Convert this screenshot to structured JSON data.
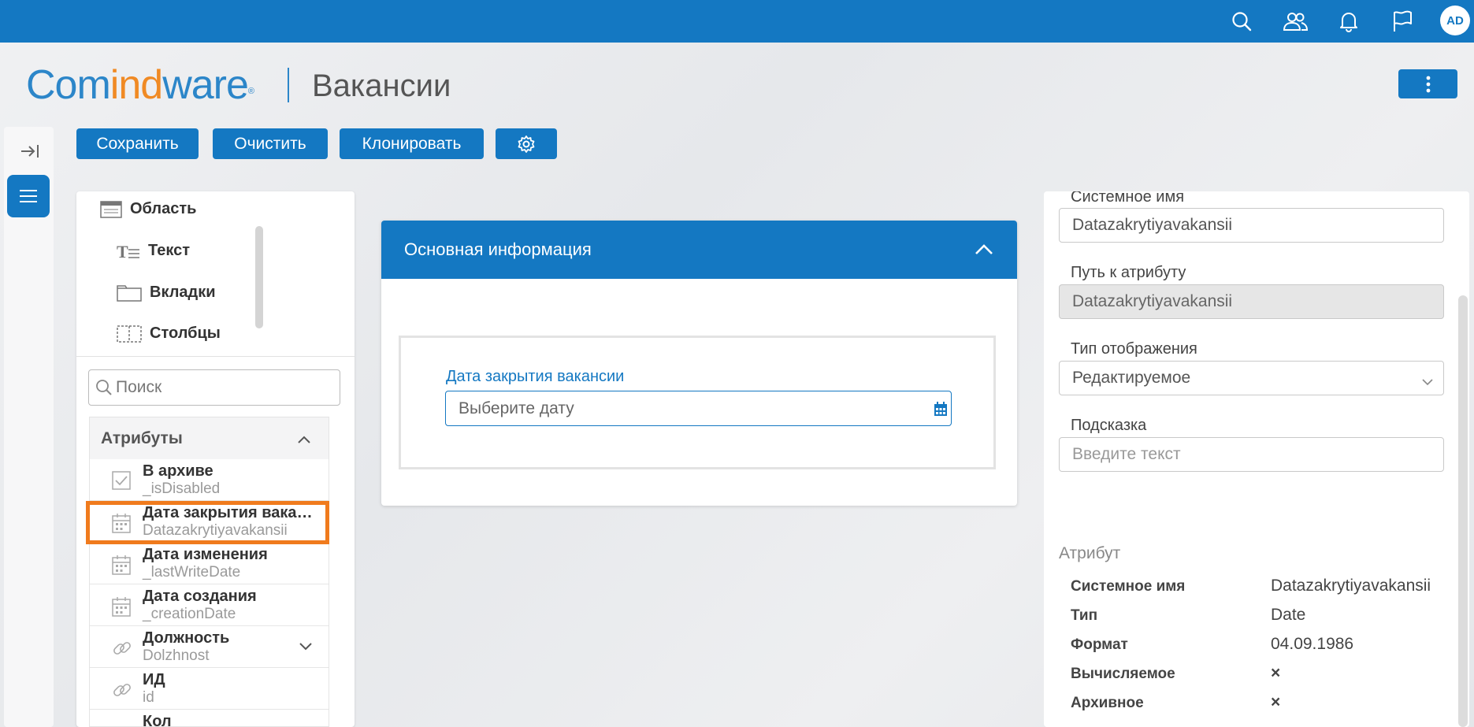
{
  "topbar": {
    "icons": [
      "search-icon",
      "users-icon",
      "bell-icon",
      "flag-icon"
    ],
    "avatar": "AD",
    "accent": "#1478c2"
  },
  "header": {
    "logo": {
      "part1": "Com",
      "part2": "ind",
      "part3": "ware",
      "mark": "®"
    },
    "title": "Вакансии"
  },
  "toolbar": {
    "save_label": "Сохранить",
    "clear_label": "Очистить",
    "clone_label": "Клонировать"
  },
  "palette": {
    "items": [
      {
        "label": "Область",
        "icon": "area-icon"
      },
      {
        "label": "Текст",
        "icon": "text-icon"
      },
      {
        "label": "Вкладки",
        "icon": "tabs-icon"
      },
      {
        "label": "Столбцы",
        "icon": "columns-icon"
      }
    ],
    "search_placeholder": "Поиск",
    "attributes_title": "Атрибуты",
    "attributes": [
      {
        "name": "В архиве",
        "system": "_isDisabled",
        "icon": "checkbox-icon"
      },
      {
        "name": "Дата закрытия вакансии",
        "system": "Datazakrytiyavakansii",
        "icon": "calendar-icon",
        "selected": true
      },
      {
        "name": "Дата изменения",
        "system": "_lastWriteDate",
        "icon": "calendar-icon"
      },
      {
        "name": "Дата создания",
        "system": "_creationDate",
        "icon": "calendar-icon"
      },
      {
        "name": "Должность",
        "system": "Dolzhnost",
        "icon": "link-icon",
        "expandable": true
      },
      {
        "name": "ИД",
        "system": "id",
        "icon": "link-icon"
      },
      {
        "name": "Кол",
        "system": "",
        "icon": "number-icon"
      }
    ]
  },
  "form": {
    "section_title": "Основная информация",
    "field_label": "Дата закрытия вакансии",
    "field_placeholder": "Выберите дату"
  },
  "properties": {
    "system_name_label": "Системное имя",
    "system_name_value": "Datazakrytiyavakansii",
    "path_label": "Путь к атрибуту",
    "path_value": "Datazakrytiyavakansii",
    "display_type_label": "Тип отображения",
    "display_type_value": "Редактируемое",
    "hint_label": "Подсказка",
    "hint_placeholder": "Введите текст",
    "attribute_section": "Атрибут",
    "info": [
      {
        "key": "Системное имя",
        "value": "Datazakrytiyavakansii"
      },
      {
        "key": "Тип",
        "value": "Date"
      },
      {
        "key": "Формат",
        "value": "04.09.1986"
      },
      {
        "key": "Вычисляемое",
        "value": "×"
      },
      {
        "key": "Архивное",
        "value": "×"
      }
    ]
  }
}
